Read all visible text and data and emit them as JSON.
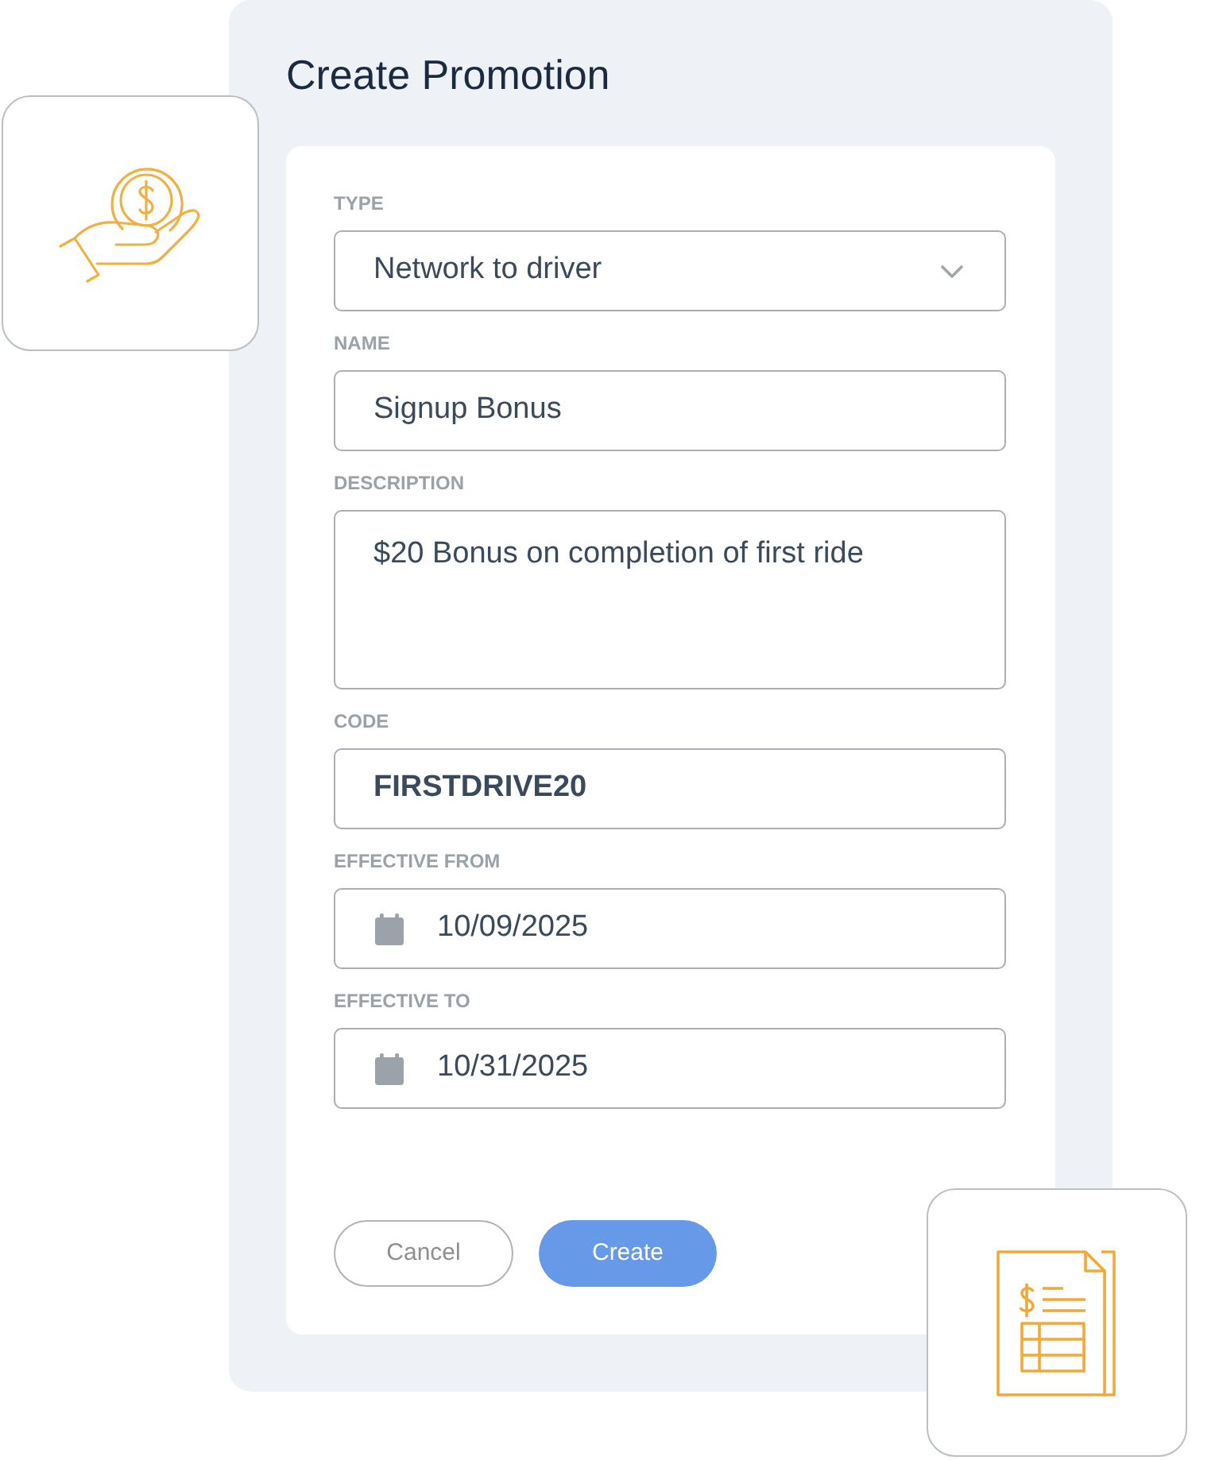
{
  "title": "Create Promotion",
  "form": {
    "fields": [
      {
        "kind": "select",
        "label": "TYPE",
        "value": "Network to driver"
      },
      {
        "kind": "text",
        "label": "NAME",
        "value": "Signup Bonus"
      },
      {
        "kind": "textarea",
        "label": "DESCRIPTION",
        "value": "$20 Bonus on completion of first ride"
      },
      {
        "kind": "code",
        "label": "CODE",
        "value": "FIRSTDRIVE20"
      },
      {
        "kind": "date",
        "label": "EFFECTIVE FROM",
        "value": "10/09/2025"
      },
      {
        "kind": "date",
        "label": "EFFECTIVE TO",
        "value": "10/31/2025"
      }
    ],
    "buttons": [
      {
        "kind": "secondary",
        "label": "Cancel"
      },
      {
        "kind": "primary",
        "label": "Create"
      }
    ]
  }
}
